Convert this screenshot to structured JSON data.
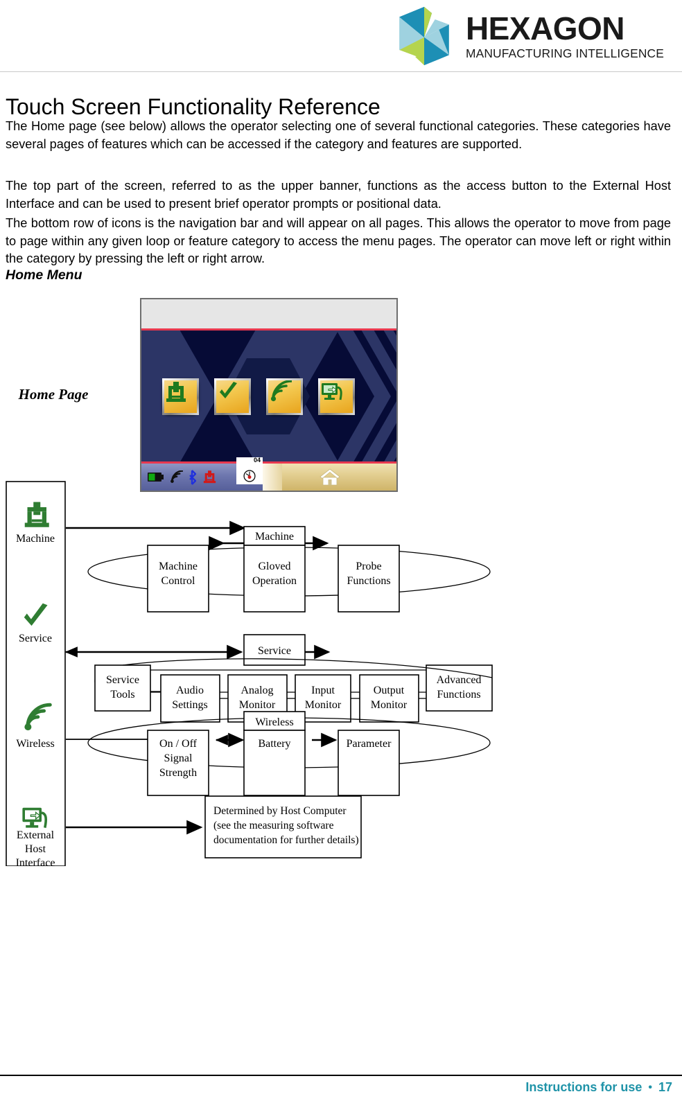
{
  "header": {
    "logo_word": "HEXAGON",
    "logo_tagline": "MANUFACTURING INTELLIGENCE",
    "logo_icon": "hexagon-logo-mark",
    "colors": {
      "teal": "#1d8fb5",
      "light_teal": "#9fd2e0",
      "green": "#b5d44e",
      "pale_green": "#cfe08a",
      "dark_text": "#1a1a1a"
    }
  },
  "document": {
    "title": "Touch Screen Functionality Reference",
    "paragraphs": [
      "The Home page (see below) allows the operator selecting one of several functional categories. These categories have several pages of features which can be accessed if the category and features are supported.",
      "The top part of the screen, referred to as the upper banner, functions as the access button to the External Host Interface and can be used to present brief operator prompts or positional data.",
      "The bottom row of icons is the navigation bar and will appear on all pages. This allows the operator to move from page to page within any given loop or feature category to access the menu pages. The operator can move left or right within the category by pressing the left or right arrow."
    ],
    "subheading": "Home Menu"
  },
  "touchscreen": {
    "caption": "Home Page",
    "banner_label": "",
    "tiles": [
      {
        "icon": "machine-icon",
        "name": "machine-tile"
      },
      {
        "icon": "checkmark-icon",
        "name": "service-tile"
      },
      {
        "icon": "wireless-signal-icon",
        "name": "wireless-tile"
      },
      {
        "icon": "external-host-interface-icon",
        "name": "external-host-interface-tile"
      }
    ],
    "navbar": {
      "status_icons": [
        {
          "icon": "battery-icon",
          "name": "battery-status-icon"
        },
        {
          "icon": "wireless-signal-icon",
          "name": "wireless-status-icon"
        },
        {
          "icon": "bluetooth-icon",
          "name": "bluetooth-status-icon"
        },
        {
          "icon": "machine-icon",
          "name": "machine-status-icon"
        },
        {
          "icon": "gauge-icon",
          "name": "probe-gauge-icon"
        }
      ],
      "gauge_value": "04",
      "home_button": {
        "icon": "home-icon",
        "name": "home-button"
      }
    },
    "colors": {
      "banner_bg": "#e6e6e6",
      "accent_red": "#e8384f",
      "screen_bg": "#060b36",
      "tile_gold": "#f0c040",
      "tile_green": "#1f7a1f",
      "navbar_left": "#6d76ae",
      "navbar_right": "#e3cf92"
    }
  },
  "diagram": {
    "categories": [
      {
        "label": "Machine",
        "icon": "machine-icon",
        "header_box": "Machine",
        "boxes": [
          "Machine Control",
          "Gloved Operation",
          "Probe Functions"
        ],
        "loop": true
      },
      {
        "label": "Service",
        "icon": "checkmark-icon",
        "header_box": "Service",
        "boxes": [
          "Service Tools",
          "Audio Settings",
          "Analog Monitor",
          "Input Monitor",
          "Output Monitor",
          "Advanced Functions"
        ],
        "loop": true
      },
      {
        "label": "Wireless",
        "icon": "wireless-signal-icon",
        "header_box": "Wireless",
        "boxes": [
          "On / Off Signal Strength",
          "Battery",
          "Parameter"
        ],
        "loop": true
      },
      {
        "label": "External Host Interface",
        "icon": "external-host-interface-icon",
        "header_box": "",
        "boxes": [
          "Determined by Host Computer (see the measuring software documentation for further details)"
        ],
        "loop": false
      }
    ],
    "box_labels": {
      "machine_header": "Machine",
      "machine_control_l1": "Machine",
      "machine_control_l2": "Control",
      "gloved_l1": "Gloved",
      "gloved_l2": "Operation",
      "probe_l1": "Probe",
      "probe_l2": "Functions",
      "service_header": "Service",
      "service_tools_l1": "Service",
      "service_tools_l2": "Tools",
      "audio_l1": "Audio",
      "audio_l2": "Settings",
      "analog_l1": "Analog",
      "analog_l2": "Monitor",
      "input_l1": "Input",
      "input_l2": "Monitor",
      "output_l1": "Output",
      "output_l2": "Monitor",
      "advanced_l1": "Advanced",
      "advanced_l2": "Functions",
      "wireless_header": "Wireless",
      "onoff_l1": "On / Off",
      "onoff_l2": "Signal",
      "onoff_l3": "Strength",
      "battery": "Battery",
      "parameter": "Parameter",
      "host_l1": "Determined by Host Computer",
      "host_l2": "(see the measuring software",
      "host_l3": "documentation for further details)"
    },
    "sidebar_labels": {
      "machine": "Machine",
      "service": "Service",
      "wireless": "Wireless",
      "external_l1": "External",
      "external_l2": "Host",
      "external_l3": "Interface"
    }
  },
  "footer": {
    "text": "Instructions for use",
    "separator": "•",
    "page_number": "17",
    "color": "#1f93a8"
  }
}
